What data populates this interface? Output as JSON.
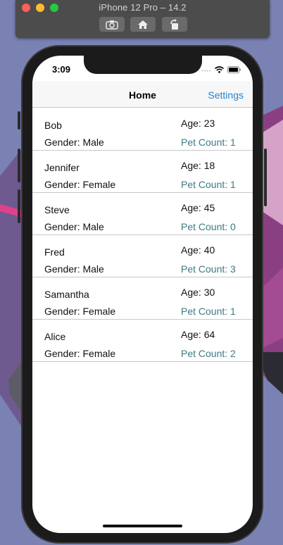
{
  "simulator": {
    "title": "iPhone 12 Pro – 14.2",
    "buttons": [
      "screenshot-icon",
      "home-icon",
      "rotate-icon"
    ]
  },
  "status_bar": {
    "time": "3:09",
    "icons": [
      "signal-icon",
      "wifi-icon",
      "battery-icon"
    ]
  },
  "nav": {
    "title": "Home",
    "settings_label": "Settings"
  },
  "people": [
    {
      "name": "Bob",
      "age": "Age: 23",
      "gender": "Gender: Male",
      "pets": "Pet Count: 1"
    },
    {
      "name": "Jennifer",
      "age": "Age: 18",
      "gender": "Gender: Female",
      "pets": "Pet Count: 1"
    },
    {
      "name": "Steve",
      "age": "Age: 45",
      "gender": "Gender: Male",
      "pets": "Pet Count: 0"
    },
    {
      "name": "Fred",
      "age": "Age: 40",
      "gender": "Gender: Male",
      "pets": "Pet Count: 3"
    },
    {
      "name": "Samantha",
      "age": "Age: 30",
      "gender": "Gender: Female",
      "pets": "Pet Count: 1"
    },
    {
      "name": "Alice",
      "age": "Age: 64",
      "gender": "Gender: Female",
      "pets": "Pet Count: 2"
    }
  ],
  "colors": {
    "accent": "#2384d5",
    "pet_count": "#3e7a85",
    "wallpaper": "#7a82b4"
  }
}
